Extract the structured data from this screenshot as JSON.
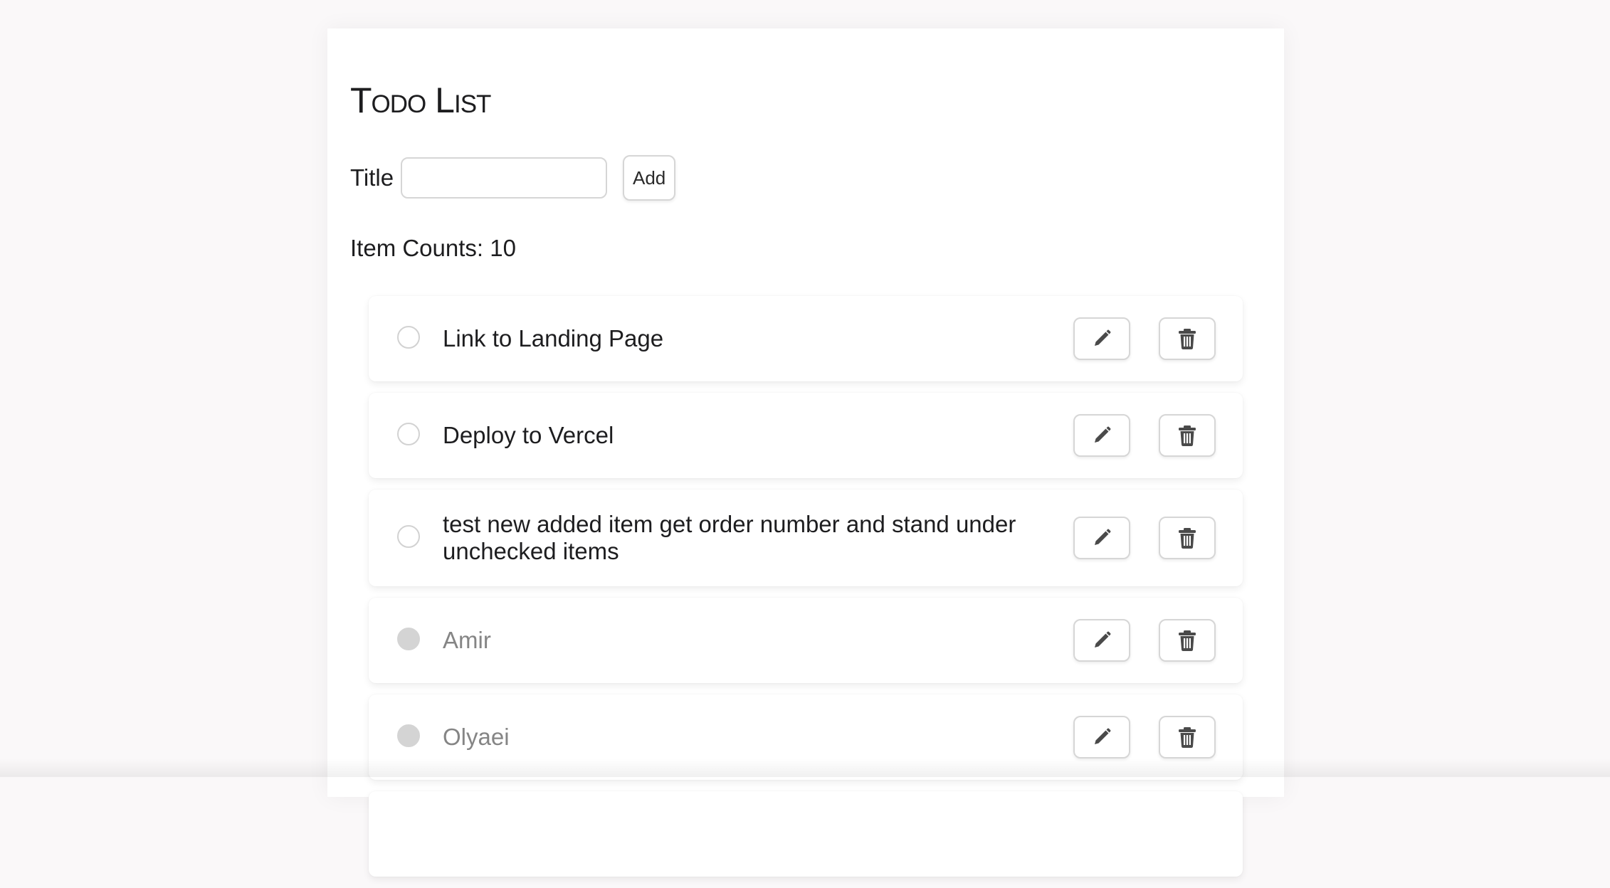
{
  "header": {
    "title": "Todo List"
  },
  "form": {
    "label": "Title",
    "input_value": "",
    "add_label": "Add"
  },
  "stats": {
    "count_text": "Item Counts: 10"
  },
  "icons": {
    "edit": "pencil-icon",
    "delete": "trash-icon",
    "checkbox": "circle-checkbox"
  },
  "colors": {
    "text": "#1d1d1f",
    "done_text": "#858585",
    "done_check": "#d4d4d4",
    "icon": "#4a4a4a"
  },
  "items": [
    {
      "text": "Link to Landing Page",
      "checked": false
    },
    {
      "text": "Deploy to Vercel",
      "checked": false
    },
    {
      "text": "test new added item get order number and stand under unchecked items",
      "checked": false
    },
    {
      "text": "Amir",
      "checked": true
    },
    {
      "text": "Olyaei",
      "checked": true
    }
  ]
}
